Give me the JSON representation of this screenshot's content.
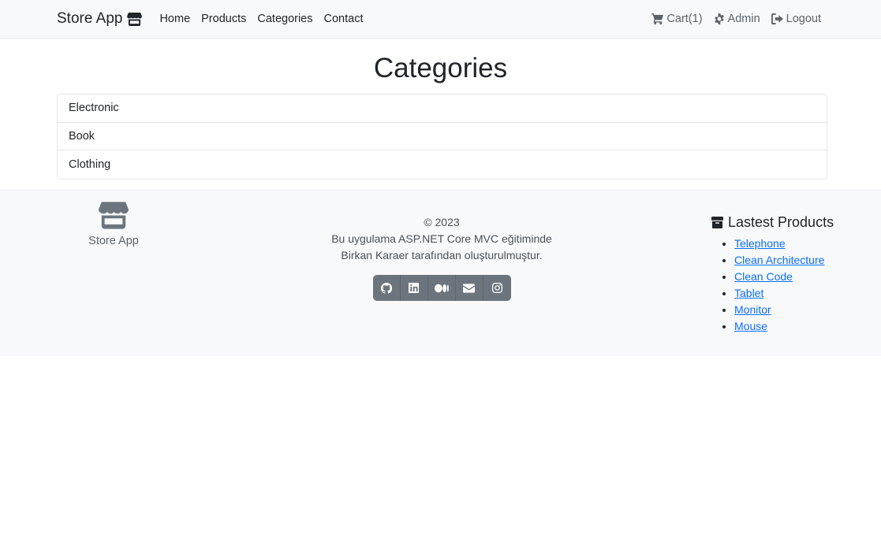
{
  "navbar": {
    "brand": "Store App",
    "links": [
      "Home",
      "Products",
      "Categories",
      "Contact"
    ],
    "cart_label": "Cart(1)",
    "admin_label": "Admin",
    "logout_label": "Logout"
  },
  "main": {
    "title": "Categories",
    "categories": [
      "Electronic",
      "Book",
      "Clothing"
    ]
  },
  "footer": {
    "brand": "Store App",
    "copyright": "© 2023",
    "line1": "Bu uygulama ASP.NET Core MVC eğitiminde",
    "line2": "Birkan Karaer tarafından oluşturulmuştur.",
    "social_icons": [
      "github-icon",
      "linkedin-icon",
      "medium-icon",
      "envelope-icon",
      "instagram-icon"
    ],
    "latest_title": "Lastest Products",
    "latest_products": [
      "Telephone",
      "Clean Architecture",
      "Clean Code",
      "Tablet",
      "Monitor",
      "Mouse"
    ]
  },
  "colors": {
    "navbar_bg": "#f8f9fa",
    "link_blue": "#0d6efd",
    "button_gray": "#6c757d"
  }
}
